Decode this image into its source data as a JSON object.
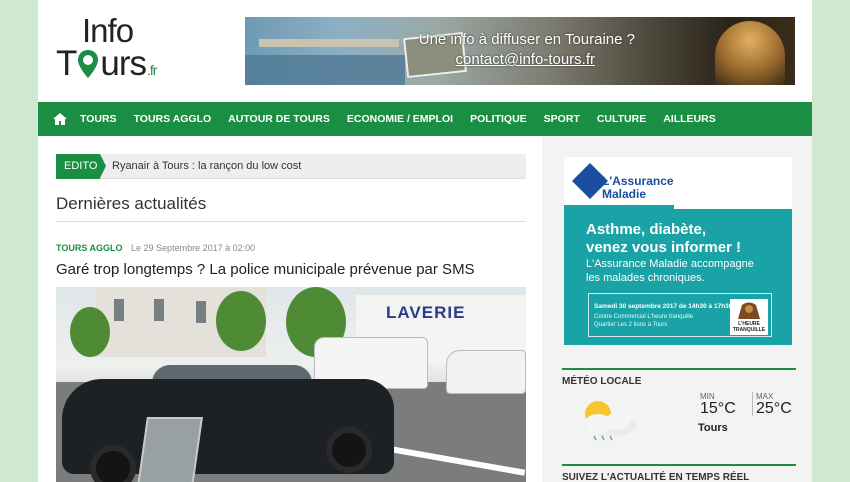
{
  "logo": {
    "line1": "Info",
    "line2_a": "T",
    "line2_b": "urs",
    "suffix": ".fr"
  },
  "banner": {
    "tagline": "Une info à diffuser en Touraine ?",
    "email": "contact@info-tours.fr"
  },
  "nav": {
    "home_icon": "home-icon",
    "items": [
      "TOURS",
      "TOURS AGGLO",
      "AUTOUR DE TOURS",
      "ECONOMIE / EMPLOI",
      "POLITIQUE",
      "SPORT",
      "CULTURE",
      "AILLEURS"
    ]
  },
  "edito": {
    "tag": "EDITO",
    "text": "Ryanair à Tours : la rançon du low cost"
  },
  "section": {
    "title": "Dernières actualités"
  },
  "article": {
    "category": "TOURS AGGLO",
    "date": "Le 29 Septembre 2017 à 02:00",
    "title": "Garé trop longtemps ? La police municipale prévenue par SMS",
    "photo_text": "LAVERIE"
  },
  "ad": {
    "brand": "L'Assurance Maladie",
    "headline_1": "Asthme, diabète,",
    "headline_2": "venez vous informer !",
    "body_1": "L'Assurance Maladie accompagne",
    "body_2": "les malades chroniques.",
    "event_date": "Samedi 30 septembre 2017 de 14h30 à 17h30",
    "event_place_1": "Centre Commercial L'heure tranquille",
    "event_place_2": "Quartier Les 2 lions à Tours",
    "partner": "L'HEURE TRANQUILLE"
  },
  "meteo": {
    "title": "MÉTÉO LOCALE",
    "min_label": "MIN",
    "max_label": "MAX",
    "min": "15°C",
    "max": "25°C",
    "city": "Tours",
    "icon": "partly-cloudy-icon"
  },
  "realtime": {
    "title": "SUIVEZ L'ACTUALITÉ EN TEMPS RÉEL"
  },
  "colors": {
    "brand_green": "#1a8f44",
    "ad_teal": "#1aa3a6",
    "ad_blue": "#1b4ea1"
  }
}
